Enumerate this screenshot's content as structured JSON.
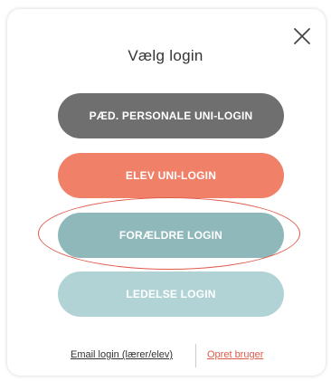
{
  "dialog": {
    "title": "Vælg login",
    "close_icon": "close-icon"
  },
  "buttons": {
    "staff_label": "PÆD. PERSONALE UNI-LOGIN",
    "pupil_label": "ELEV UNI-LOGIN",
    "parent_label": "FORÆLDRE LOGIN",
    "management_label": "LEDELSE LOGIN"
  },
  "footer": {
    "email_login_label": "Email login (lærer/elev)",
    "create_user_label": "Opret bruger"
  },
  "colors": {
    "staff": "#6f6f6f",
    "pupil": "#f08068",
    "parent": "#8fb8bb",
    "management": "#b2d3d6",
    "accent_red": "#e05a4a"
  }
}
